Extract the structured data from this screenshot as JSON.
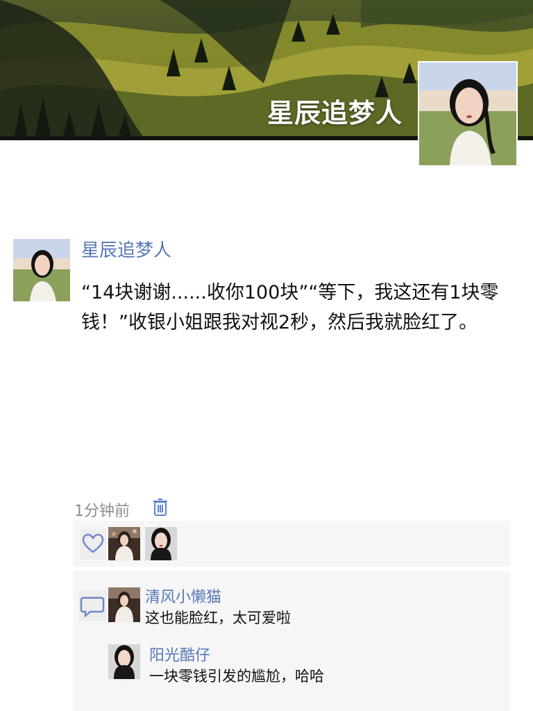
{
  "cover": {
    "title": "星辰追梦人"
  },
  "post": {
    "author": "星辰追梦人",
    "text": "“14块谢谢......收你100块”“等下，我这还有1块零钱！”收银小姐跟我对视2秒，然后我就脸红了。",
    "time": "1分钟前"
  },
  "icons": {
    "trash": "trash-icon",
    "like": "heart-icon",
    "comment": "comment-icon"
  },
  "colors": {
    "name_link": "#5677b7",
    "panel_bg": "#f6f6f6"
  },
  "comments": [
    {
      "name": "清风小懒猫",
      "text": "这也能脸红，太可爱啦"
    },
    {
      "name": "阳光酷仔",
      "text": "一块零钱引发的尴尬，哈哈"
    }
  ]
}
